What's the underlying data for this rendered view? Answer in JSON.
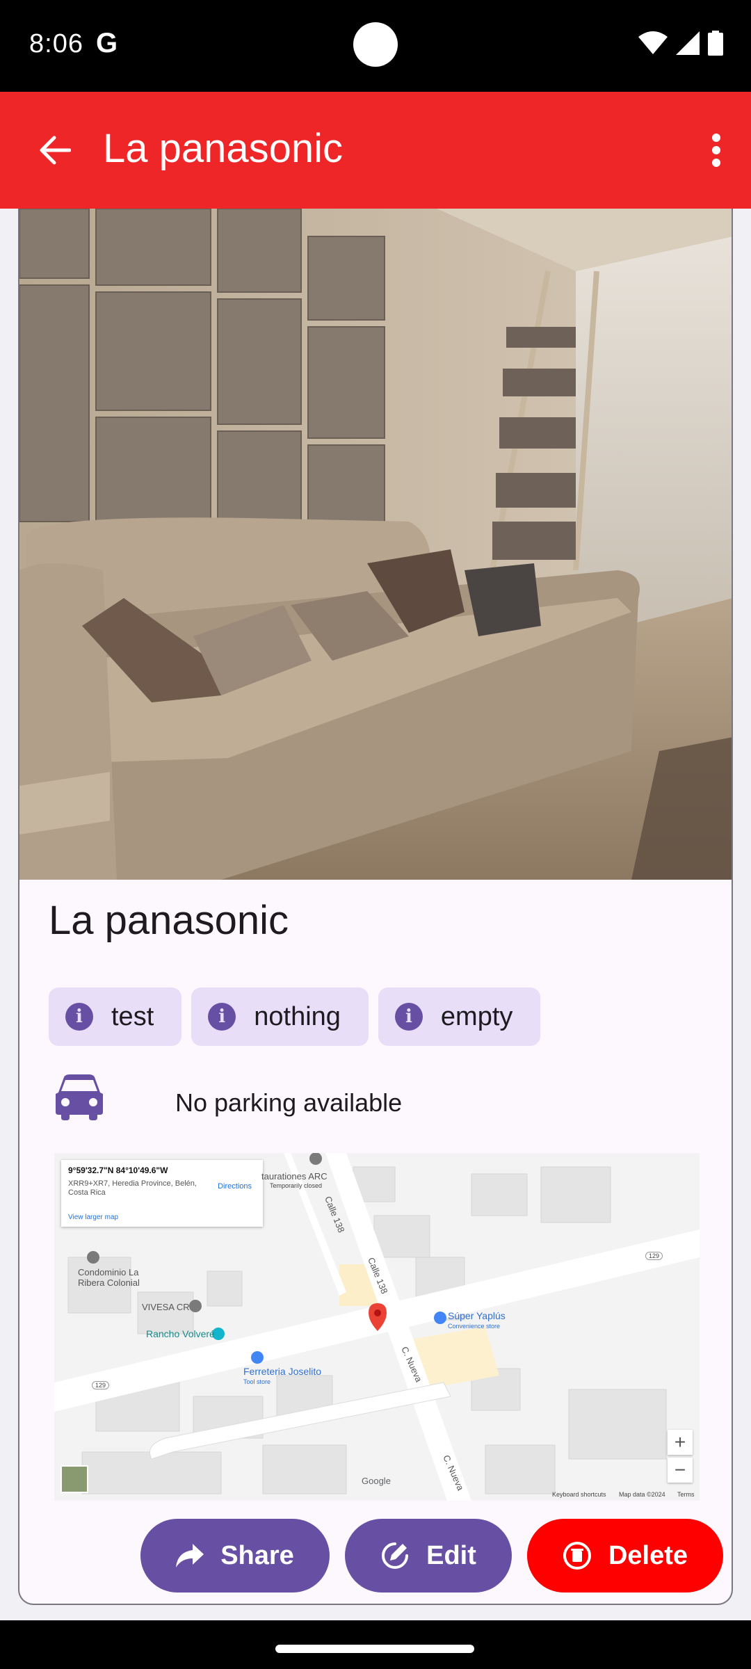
{
  "status_bar": {
    "time": "8:06",
    "g_letter": "G"
  },
  "app_bar": {
    "title": "La panasonic"
  },
  "place": {
    "title": "La panasonic",
    "tags": [
      "test",
      "nothing",
      "empty"
    ],
    "tag_icon_glyph": "i",
    "parking_text": "No parking available"
  },
  "map": {
    "coords": "9°59'32.7\"N 84°10'49.6\"W",
    "address": "XRR9+XR7, Heredia Province, Belén, Costa Rica",
    "directions_label": "Directions",
    "view_larger_label": "View larger map",
    "labels": {
      "restauraciones": "taurationes ARC",
      "temporarily_closed": "Temporarily closed",
      "condominio": "Condominio La Ribera Colonial",
      "vivesa": "VIVESA CR",
      "rancho": "Rancho Volveré",
      "ferreteria": "Ferreteria Joselito",
      "tool_store": "Tool store",
      "super": "Súper Yaplús",
      "convenience": "Convenience store",
      "calle138a": "Calle 138",
      "calle138b": "Calle 138",
      "cnueva1": "C. Nueva",
      "cnueva2": "C. Nueva",
      "route129a": "129",
      "route129b": "129",
      "google": "Google",
      "keyboard": "Keyboard shortcuts",
      "map_data": "Map data ©2024",
      "terms": "Terms"
    },
    "zoom_in": "+",
    "zoom_out": "−"
  },
  "actions": {
    "share": "Share",
    "edit": "Edit",
    "delete": "Delete"
  },
  "colors": {
    "app_bar": "#ee2628",
    "primary": "#6750a4",
    "chip_bg": "#e8def8",
    "delete": "#fe0000"
  },
  "icons": {
    "back": "arrow-left-icon",
    "more": "more-vert-icon",
    "tag": "info-icon",
    "parking": "car-icon",
    "share": "share-icon",
    "edit": "edit-icon",
    "delete": "delete-icon"
  }
}
